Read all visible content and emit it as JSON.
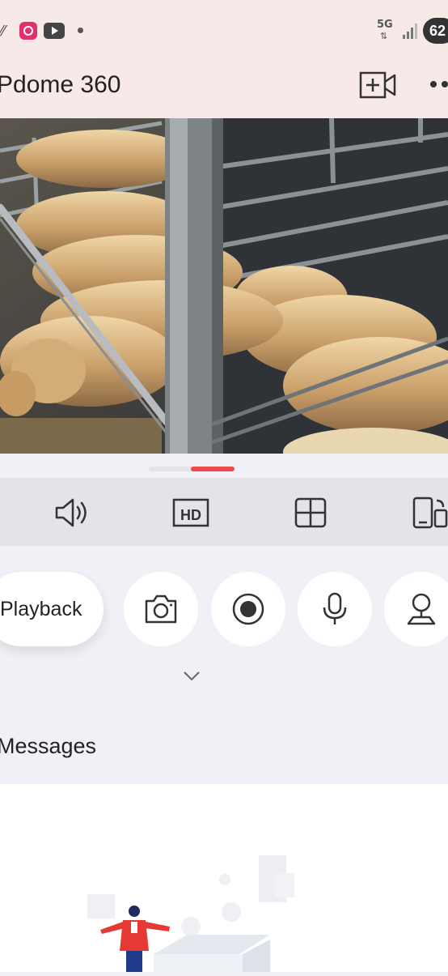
{
  "status_bar": {
    "network_type": "5G",
    "battery": "62"
  },
  "header": {
    "title": "Pdome 360"
  },
  "controls": {
    "hd_label": "HD"
  },
  "actions": {
    "playback_label": "Playback"
  },
  "messages": {
    "title": "Messages"
  },
  "colors": {
    "accent": "#ee4a4a",
    "header_bg": "#f8e9e9",
    "control_bar_bg": "#e3e3e8",
    "page_bg": "#f1f0f6"
  }
}
